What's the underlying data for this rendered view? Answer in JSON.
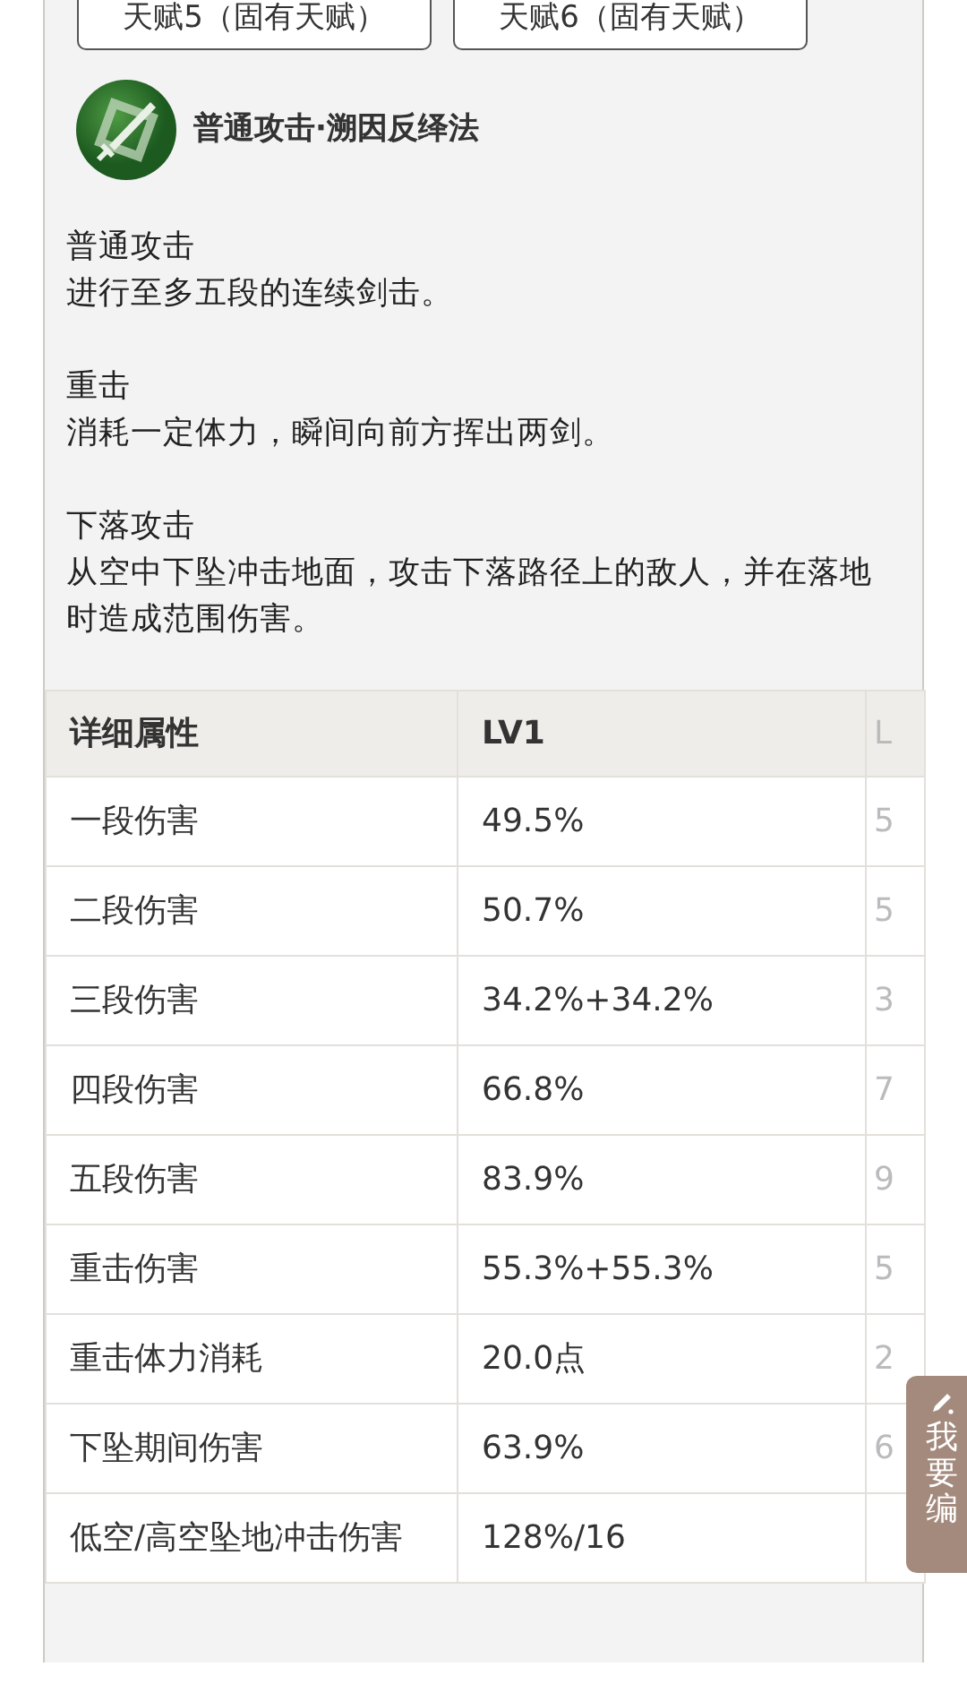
{
  "talent_tabs": [
    {
      "label": "天赋5（固有天赋）"
    },
    {
      "label": "天赋6（固有天赋）"
    }
  ],
  "skill": {
    "title": "普通攻击·溯因反绎法"
  },
  "descriptions": [
    {
      "heading": "普通攻击",
      "text": "进行至多五段的连续剑击。"
    },
    {
      "heading": "重击",
      "text": "消耗一定体力，瞬间向前方挥出两剑。"
    },
    {
      "heading": "下落攻击",
      "text": "从空中下坠冲击地面，攻击下落路径上的敌人，并在落地时造成范围伤害。"
    }
  ],
  "table": {
    "columns": [
      "详细属性",
      "LV1",
      "L"
    ],
    "rows": [
      [
        "一段伤害",
        "49.5%",
        "5"
      ],
      [
        "二段伤害",
        "50.7%",
        "5"
      ],
      [
        "三段伤害",
        "34.2%+34.2%",
        "3"
      ],
      [
        "四段伤害",
        "66.8%",
        "7"
      ],
      [
        "五段伤害",
        "83.9%",
        "9"
      ],
      [
        "重击伤害",
        "55.3%+55.3%",
        "5"
      ],
      [
        "重击体力消耗",
        "20.0点",
        "2"
      ],
      [
        "下坠期间伤害",
        "63.9%",
        "6"
      ],
      [
        "低空/高空坠地冲击伤害",
        "128%/16",
        ""
      ]
    ]
  },
  "edit_button": {
    "label": "我要编"
  }
}
